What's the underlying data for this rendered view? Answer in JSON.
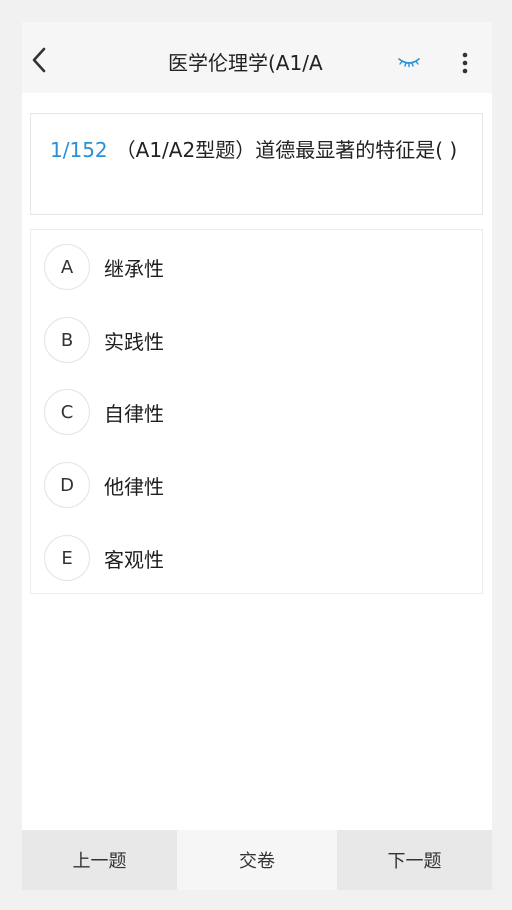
{
  "header": {
    "title": "医学伦理学(A1/A",
    "back_icon": "chevron-left-icon",
    "eye_icon": "closed-eye-icon",
    "more_icon": "more-vertical-icon",
    "accent_color": "#2a8fd6"
  },
  "question": {
    "index": "1/152",
    "text": "（A1/A2型题）道德最显著的特征是( )"
  },
  "options": [
    {
      "letter": "A",
      "text": "继承性"
    },
    {
      "letter": "B",
      "text": "实践性"
    },
    {
      "letter": "C",
      "text": "自律性"
    },
    {
      "letter": "D",
      "text": "他律性"
    },
    {
      "letter": "E",
      "text": "客观性"
    }
  ],
  "footer": {
    "prev_label": "上一题",
    "submit_label": "交卷",
    "next_label": "下一题"
  }
}
